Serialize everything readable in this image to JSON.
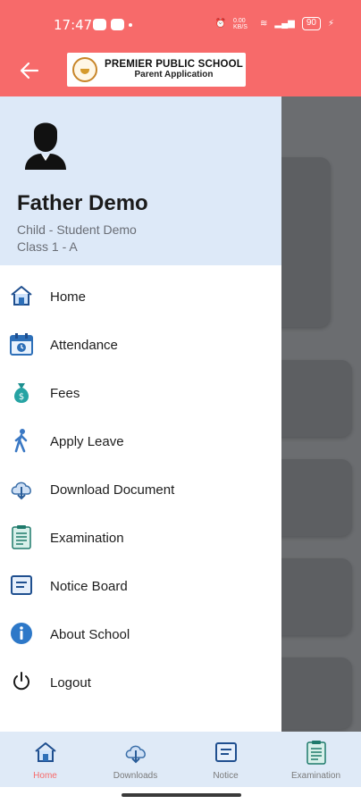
{
  "status_bar": {
    "time": "17:47",
    "network_speed": "0.00 KB/S",
    "battery": "90"
  },
  "app_bar": {
    "school_name": "PREMIER PUBLIC SCHOOL",
    "app_subtitle": "Parent Application"
  },
  "drawer": {
    "parent_name": "Father Demo",
    "child": "Child - Student Demo",
    "class": "Class 1 - A",
    "items": [
      {
        "label": "Home",
        "icon": "home-icon"
      },
      {
        "label": "Attendance",
        "icon": "calendar-icon"
      },
      {
        "label": "Fees",
        "icon": "money-bag-icon"
      },
      {
        "label": "Apply Leave",
        "icon": "walking-person-icon"
      },
      {
        "label": "Download Document",
        "icon": "cloud-download-icon"
      },
      {
        "label": "Examination",
        "icon": "exam-sheet-icon"
      },
      {
        "label": "Notice Board",
        "icon": "notice-board-icon"
      },
      {
        "label": "About School",
        "icon": "info-icon"
      },
      {
        "label": "Logout",
        "icon": "power-icon"
      }
    ]
  },
  "bottom_nav": [
    {
      "label": "Home",
      "active": true
    },
    {
      "label": "Downloads",
      "active": false
    },
    {
      "label": "Notice",
      "active": false
    },
    {
      "label": "Examination",
      "active": false
    }
  ],
  "colors": {
    "primary": "#f76a6a",
    "drawer_header": "#dde9f8",
    "icon_blue": "#2d6fb8"
  }
}
